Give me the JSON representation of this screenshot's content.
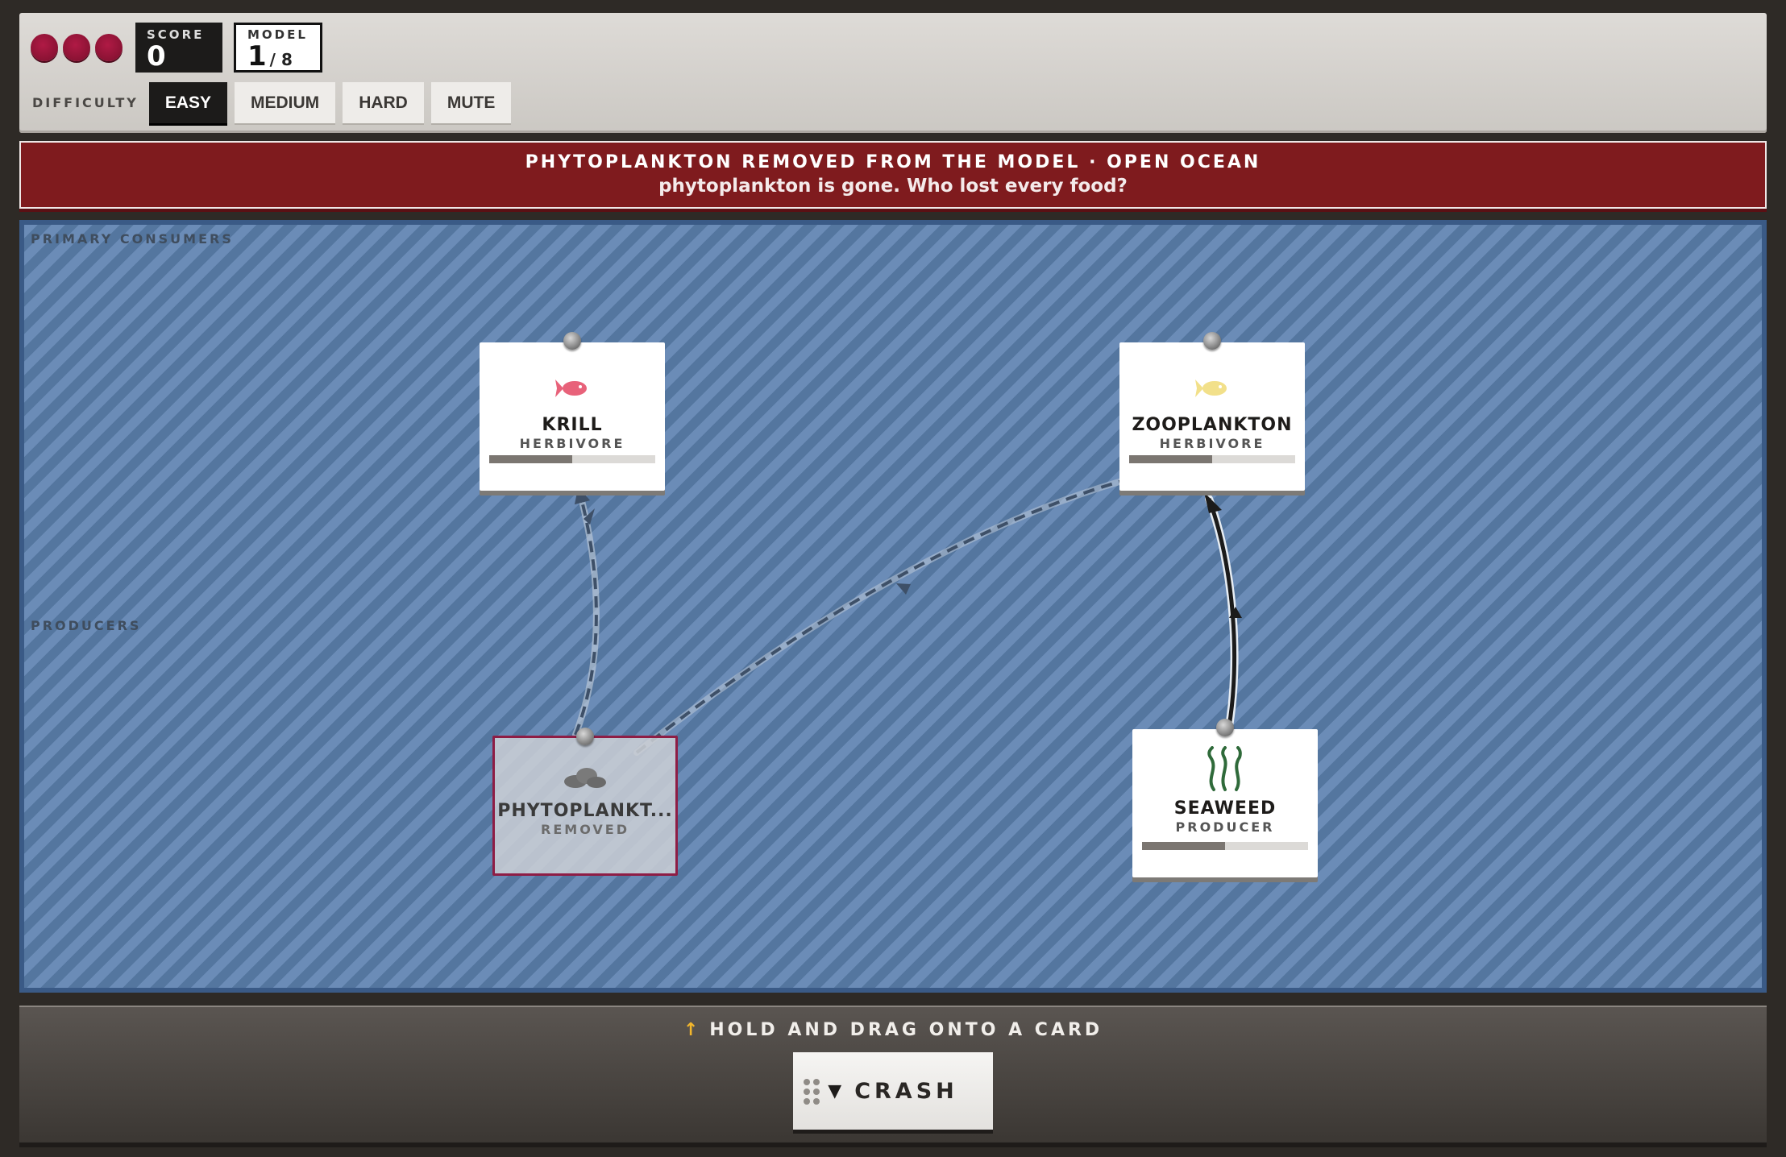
{
  "hud": {
    "lives": 3,
    "score_label": "SCORE",
    "score_value": "0",
    "model_label": "MODEL",
    "model_current": "1",
    "model_total": "/ 8",
    "difficulty_label": "DIFFICULTY",
    "difficulty_options": [
      "EASY",
      "MEDIUM",
      "HARD"
    ],
    "selected_difficulty": "EASY",
    "mute_label": "MUTE"
  },
  "alert": {
    "title": "PHYTOPLANKTON REMOVED FROM THE MODEL · OPEN OCEAN",
    "subtitle": "phytoplankton is gone. Who lost every food?"
  },
  "board": {
    "row_labels": [
      "PRIMARY CONSUMERS",
      "PRODUCERS"
    ],
    "cards": [
      {
        "name": "KRILL",
        "role": "HERBIVORE",
        "level": 0.5,
        "icon": "fish-icon",
        "icon_color": "#e8627a"
      },
      {
        "name": "ZOOPLANKTON",
        "role": "HERBIVORE",
        "level": 0.5,
        "icon": "fish-icon",
        "icon_color": "#f2e08a"
      },
      {
        "name": "PHYTOPLANKT...",
        "role": "REMOVED",
        "icon": "algae-cluster-icon",
        "removed": true
      },
      {
        "name": "SEAWEED",
        "role": "PRODUCER",
        "level": 0.5,
        "icon": "seaweed-icon",
        "icon_color": "#2f6a3a"
      }
    ]
  },
  "tray": {
    "hint": "HOLD AND DRAG ONTO A CARD",
    "tool_label": "CRASH",
    "tool_arrow": "▼"
  },
  "colors": {
    "life": "#9b1540",
    "alert_bg": "#7f1b1e",
    "board_bg": "#5c7fac",
    "removed_border": "#8e1d45"
  }
}
